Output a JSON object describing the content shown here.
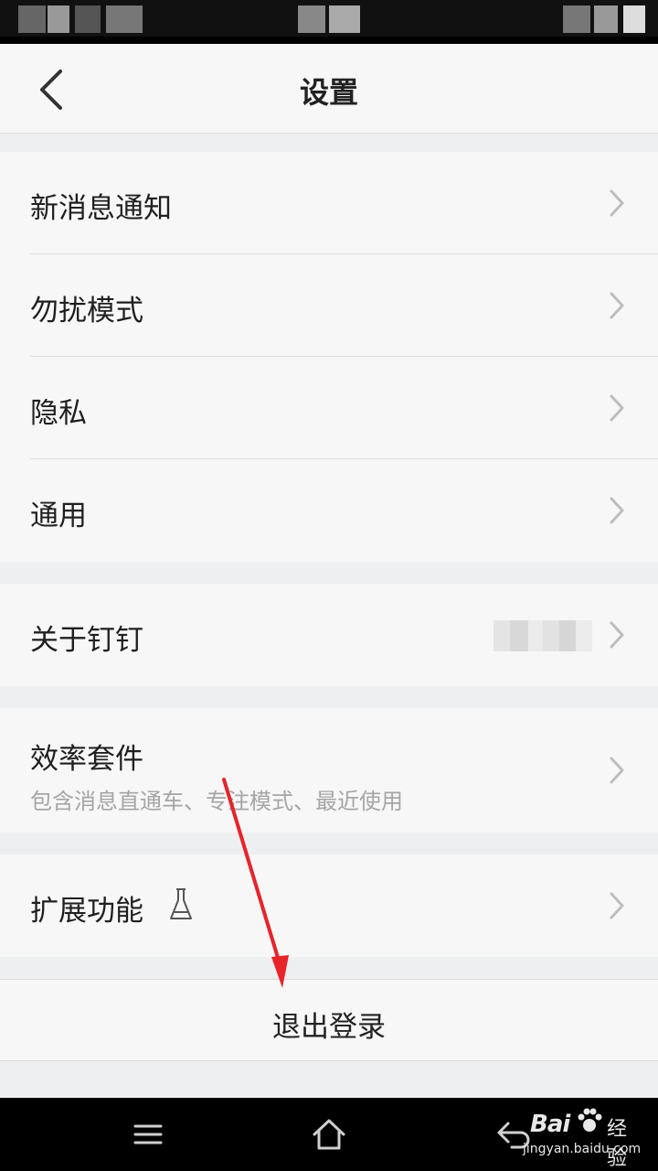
{
  "header": {
    "title": "设置"
  },
  "groups": [
    {
      "items": [
        {
          "label": "新消息通知"
        },
        {
          "label": "勿扰模式"
        },
        {
          "label": "隐私"
        },
        {
          "label": "通用"
        }
      ]
    },
    {
      "items": [
        {
          "label": "关于钉钉"
        }
      ]
    },
    {
      "items": [
        {
          "label": "效率套件",
          "subtitle": "包含消息直通车、专注模式、最近使用"
        }
      ]
    },
    {
      "items": [
        {
          "label": "扩展功能"
        }
      ]
    }
  ],
  "logout": {
    "label": "退出登录"
  },
  "watermark": {
    "brand": "Bai",
    "brand_suffix": "经验",
    "url": "jingyan.baidu.com"
  },
  "colors": {
    "background": "#eeeff1",
    "card": "#f7f7f7",
    "annotation_arrow": "#e8232a"
  },
  "icons": {
    "back": "chevron-left-icon",
    "row_arrow": "chevron-right-icon",
    "labs": "flask-icon",
    "menu": "menu-icon",
    "home": "home-icon",
    "back_nav": "back-icon"
  }
}
